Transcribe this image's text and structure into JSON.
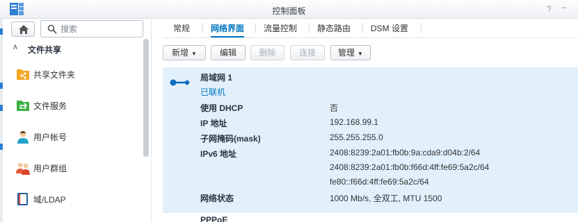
{
  "window": {
    "title": "控制面板",
    "help_label": "?",
    "minimize_label": "–"
  },
  "sidebar": {
    "search_placeholder": "搜索",
    "section": {
      "label": "文件共享"
    },
    "items": [
      {
        "label": "共享文件夹",
        "icon": "shared-folder-icon"
      },
      {
        "label": "文件服务",
        "icon": "file-services-icon"
      },
      {
        "label": "用户帐号",
        "icon": "user-icon"
      },
      {
        "label": "用户群组",
        "icon": "group-icon"
      },
      {
        "label": "域/LDAP",
        "icon": "ldap-icon"
      }
    ]
  },
  "tabs": [
    {
      "label": "常规"
    },
    {
      "label": "网络界面",
      "active": true
    },
    {
      "label": "流量控制"
    },
    {
      "label": "静态路由"
    },
    {
      "label": "DSM 设置"
    }
  ],
  "toolbar": {
    "create": "新增",
    "edit": "编辑",
    "delete": "删除",
    "connect": "连接",
    "manage": "管理"
  },
  "interfaces": [
    {
      "name": "局域网 1",
      "status": "已联机",
      "details": [
        {
          "label": "使用 DHCP",
          "values": [
            "否"
          ]
        },
        {
          "label": "IP 地址",
          "values": [
            "192.168.99.1"
          ]
        },
        {
          "label": "子网掩码(mask)",
          "values": [
            "255.255.255.0"
          ]
        },
        {
          "label": "IPv6 地址",
          "values": [
            "2408:8239:2a01:fb0b:9a:cda9:d04b:2/64",
            "2408:8239:2a01:fb0b:f66d:4ff:fe69:5a2c/64",
            "fe80::f66d:4ff:fe69:5a2c/64"
          ]
        },
        {
          "label": "网络状态",
          "values": [
            "1000 Mb/s, 全双工, MTU 1500"
          ]
        }
      ]
    },
    {
      "name": "PPPoE"
    }
  ],
  "colors": {
    "accent": "#0075c2",
    "panel_bg": "#e1f0fb"
  }
}
